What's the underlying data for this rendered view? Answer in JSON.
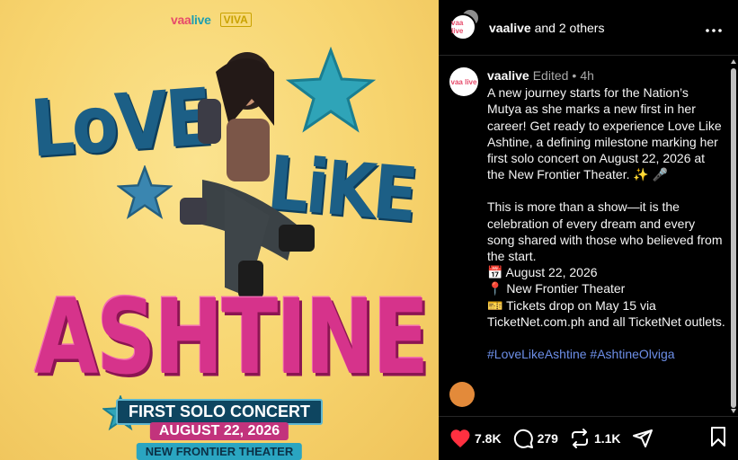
{
  "poster": {
    "brand_vaa": "vaa",
    "brand_live": "live",
    "brand_viva": "VIVA",
    "word_love": "LoVE",
    "word_like": "LiKE",
    "word_ashtine": "ASHTINE",
    "first_solo": "FIRST SOLO CONCERT",
    "date": "AUGUST 22, 2026",
    "venue": "NEW FRONTIER THEATER",
    "colors": {
      "background": "#f7d46e",
      "blue_text": "#1c5f86",
      "pink_text": "#d6338b",
      "star": "#2fa4b8"
    }
  },
  "header": {
    "username": "vaalive",
    "and_text": "and 2 others",
    "more_icon": "more-horizontal-icon",
    "avatar_text": "vaa live"
  },
  "caption": {
    "username": "vaalive",
    "edited": "Edited",
    "separator": "•",
    "time": "4h",
    "para1": "A new journey starts for the Nation’s Mutya as she marks a new first in her career! Get ready to experience Love Like Ashtine, a defining milestone marking her first solo concert on August 22, 2026 at the New Frontier Theater. ✨ 🎤",
    "para2": "This is more than a show—it is the celebration of every dream and every song shared with those who believed from the start.",
    "line_date": "📅 August 22, 2026",
    "line_venue": "📍 New Frontier Theater",
    "line_tickets": "🎫 Tickets drop on May 15 via TicketNet.com.ph and all TicketNet outlets.",
    "hashtags": "#LoveLikeAshtine #AshtineOlviga"
  },
  "next_comment": {
    "text": ""
  },
  "actions": {
    "likes": "7.8K",
    "comments": "279",
    "reposts": "1.1K",
    "like_color": "#ff3040"
  }
}
